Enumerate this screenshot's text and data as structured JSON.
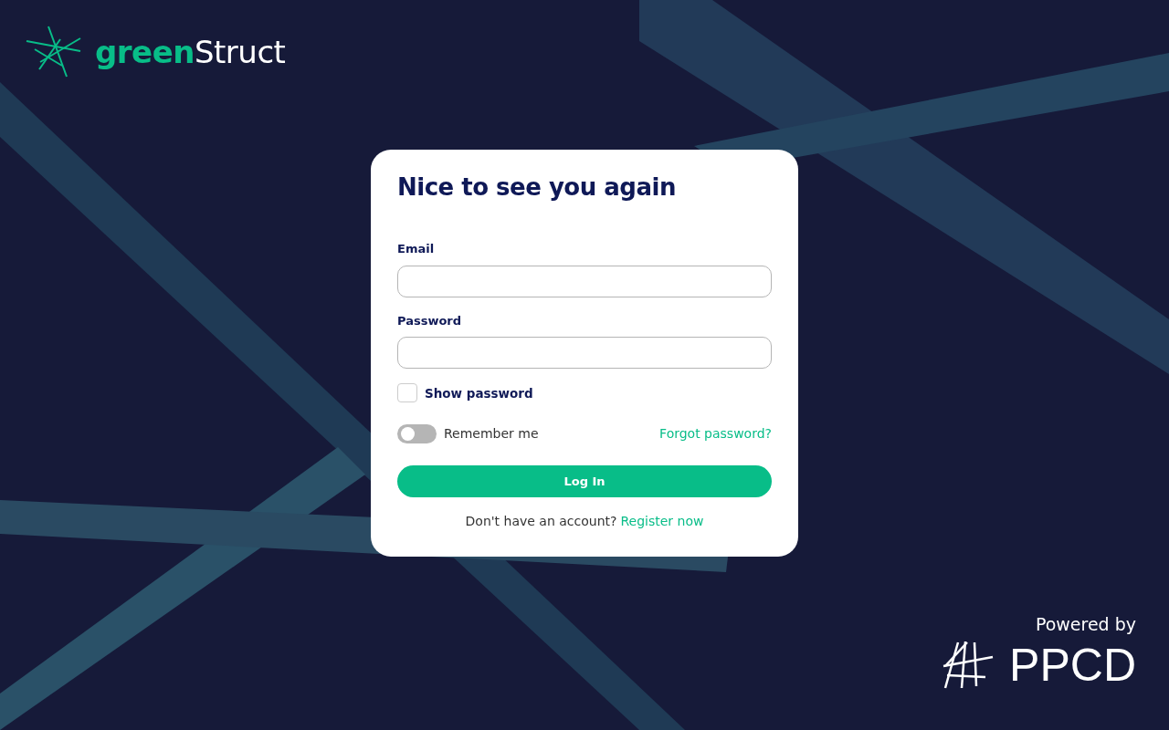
{
  "brand": {
    "name": "**green**Struct"
  },
  "login": {
    "title": "Nice to see you again",
    "fields": [
      {
        "label": "Email"
      },
      {
        "label": "Password"
      }
    ],
    "show_password": {
      "label": "Show password",
      "checked": false
    },
    "remember": {
      "label": "Remember me",
      "on": false
    },
    "forgot_link": "Forgot password?",
    "submit": "Log In",
    "register_prompt": "Don't have an account?",
    "register_link": "Register now"
  },
  "footer": {
    "powered_by": "Powered by",
    "company": "PPCD"
  }
}
